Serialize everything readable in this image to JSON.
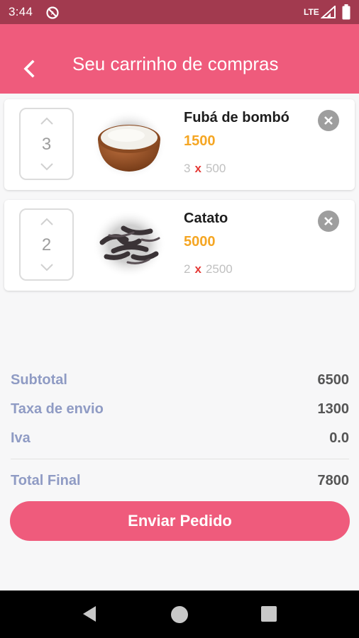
{
  "status_bar": {
    "time": "3:44",
    "network": "LTE",
    "icons": [
      "do-not-disturb-icon",
      "signal-icon",
      "battery-icon"
    ]
  },
  "app_bar": {
    "title": "Seu carrinho de compras",
    "back_icon": "chevron-left-icon"
  },
  "cart": {
    "items": [
      {
        "name": "Fubá de bombó",
        "total": "1500",
        "quantity": "3",
        "multiply": "x",
        "unit_price": "500",
        "image": "flour-bowl-image"
      },
      {
        "name": "Catato",
        "total": "5000",
        "quantity": "2",
        "multiply": "x",
        "unit_price": "2500",
        "image": "caterpillars-image"
      }
    ]
  },
  "summary": {
    "subtotal_label": "Subtotal",
    "subtotal_value": "6500",
    "shipping_label": "Taxa de envio",
    "shipping_value": "1300",
    "vat_label": "Iva",
    "vat_value": "0.0",
    "total_label": "Total Final",
    "total_value": "7800"
  },
  "actions": {
    "submit_label": "Enviar Pedido"
  },
  "colors": {
    "status_bar": "#a23a4f",
    "primary": "#ef5b7c",
    "price": "#f5a623",
    "multiply_sign": "#e53935",
    "summary_label": "#8f9bc4"
  }
}
